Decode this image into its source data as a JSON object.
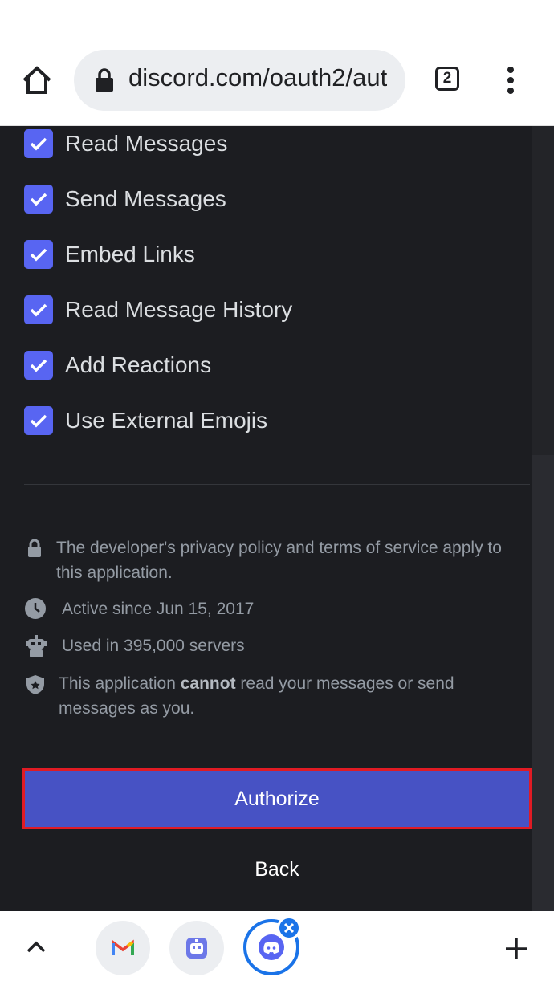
{
  "browser": {
    "url": "discord.com/oauth2/aut",
    "tab_count": "2"
  },
  "permissions": [
    {
      "label": "Read Messages",
      "checked": true
    },
    {
      "label": "Send Messages",
      "checked": true
    },
    {
      "label": "Embed Links",
      "checked": true
    },
    {
      "label": "Read Message History",
      "checked": true
    },
    {
      "label": "Add Reactions",
      "checked": true
    },
    {
      "label": "Use External Emojis",
      "checked": true
    }
  ],
  "info": {
    "privacy": "The developer's privacy policy and terms of service apply to this application.",
    "active_since": "Active since Jun 15, 2017",
    "servers": "Used in 395,000 servers",
    "cannot_pre": "This application ",
    "cannot_bold": "cannot",
    "cannot_post": " read your messages or send messages as you."
  },
  "actions": {
    "authorize_label": "Authorize",
    "back_label": "Back"
  },
  "colors": {
    "background": "#1c1d21",
    "blurple": "#5865f2",
    "authorize_bg": "#4752c4",
    "highlight_border": "#e01b24",
    "browser_accent": "#1a73e8"
  },
  "icons": {
    "home": "home-icon",
    "lock": "lock-icon",
    "tabs": "tab-switcher-icon",
    "menu": "more-vert-icon",
    "check": "check-icon",
    "clock": "clock-icon",
    "robot": "robot-icon",
    "shield": "shield-icon",
    "chevron": "chevron-up-icon",
    "gmail": "gmail-icon",
    "bot": "bot-app-icon",
    "discord": "discord-icon",
    "close": "close-icon",
    "plus": "plus-icon"
  }
}
